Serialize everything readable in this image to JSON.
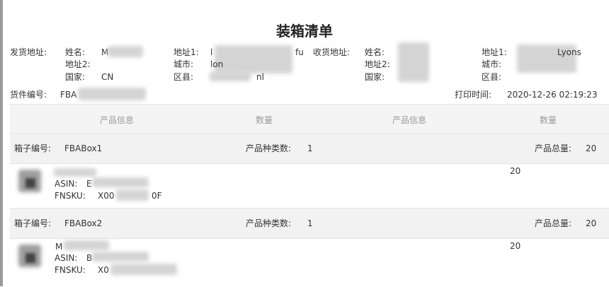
{
  "title": "装箱清单",
  "sender": {
    "label": "发货地址:",
    "name_label": "姓名:",
    "name_value": "M",
    "address1_label": "地址1:",
    "address1_value": "l",
    "address1_tail": "fu",
    "address2_label": "地址2:",
    "city_label": "城市:",
    "city_value": "lon",
    "country_label": "国家:",
    "country_value": "CN",
    "district_label": "区县:",
    "district_value": "nl"
  },
  "receiver": {
    "label": "收货地址:",
    "name_label": "姓名:",
    "address1_label": "地址1:",
    "address1_value": "Lyons",
    "address2_label": "地址2:",
    "city_label": "城市:",
    "country_label": "国家:",
    "district_label": "区县:"
  },
  "shipment_label": "货件编号:",
  "shipment_value": "FBA",
  "print_time_label": "打印时间:",
  "print_time_value": "2020-12-26 02:19:23",
  "table": {
    "headers": [
      "产品信息",
      "数量",
      "产品信息",
      "数量"
    ]
  },
  "boxes": [
    {
      "box_label": "箱子编号:",
      "box_value": "FBABox1",
      "types_label": "产品种类数:",
      "types_value": "1",
      "total_label": "产品总量:",
      "total_value": "20",
      "item": {
        "asin_label": "ASIN:",
        "asin_value": "E",
        "fnsku_label": "FNSKU:",
        "fnsku_value": "X00",
        "fnsku_tail": "0F",
        "quantity": "20"
      }
    },
    {
      "box_label": "箱子编号:",
      "box_value": "FBABox2",
      "types_label": "产品种类数:",
      "types_value": "1",
      "total_label": "产品总量:",
      "total_value": "20",
      "item": {
        "name_value": "M",
        "asin_label": "ASIN:",
        "asin_value": "B",
        "fnsku_label": "FNSKU:",
        "fnsku_value": "X0",
        "quantity": "20"
      }
    }
  ]
}
